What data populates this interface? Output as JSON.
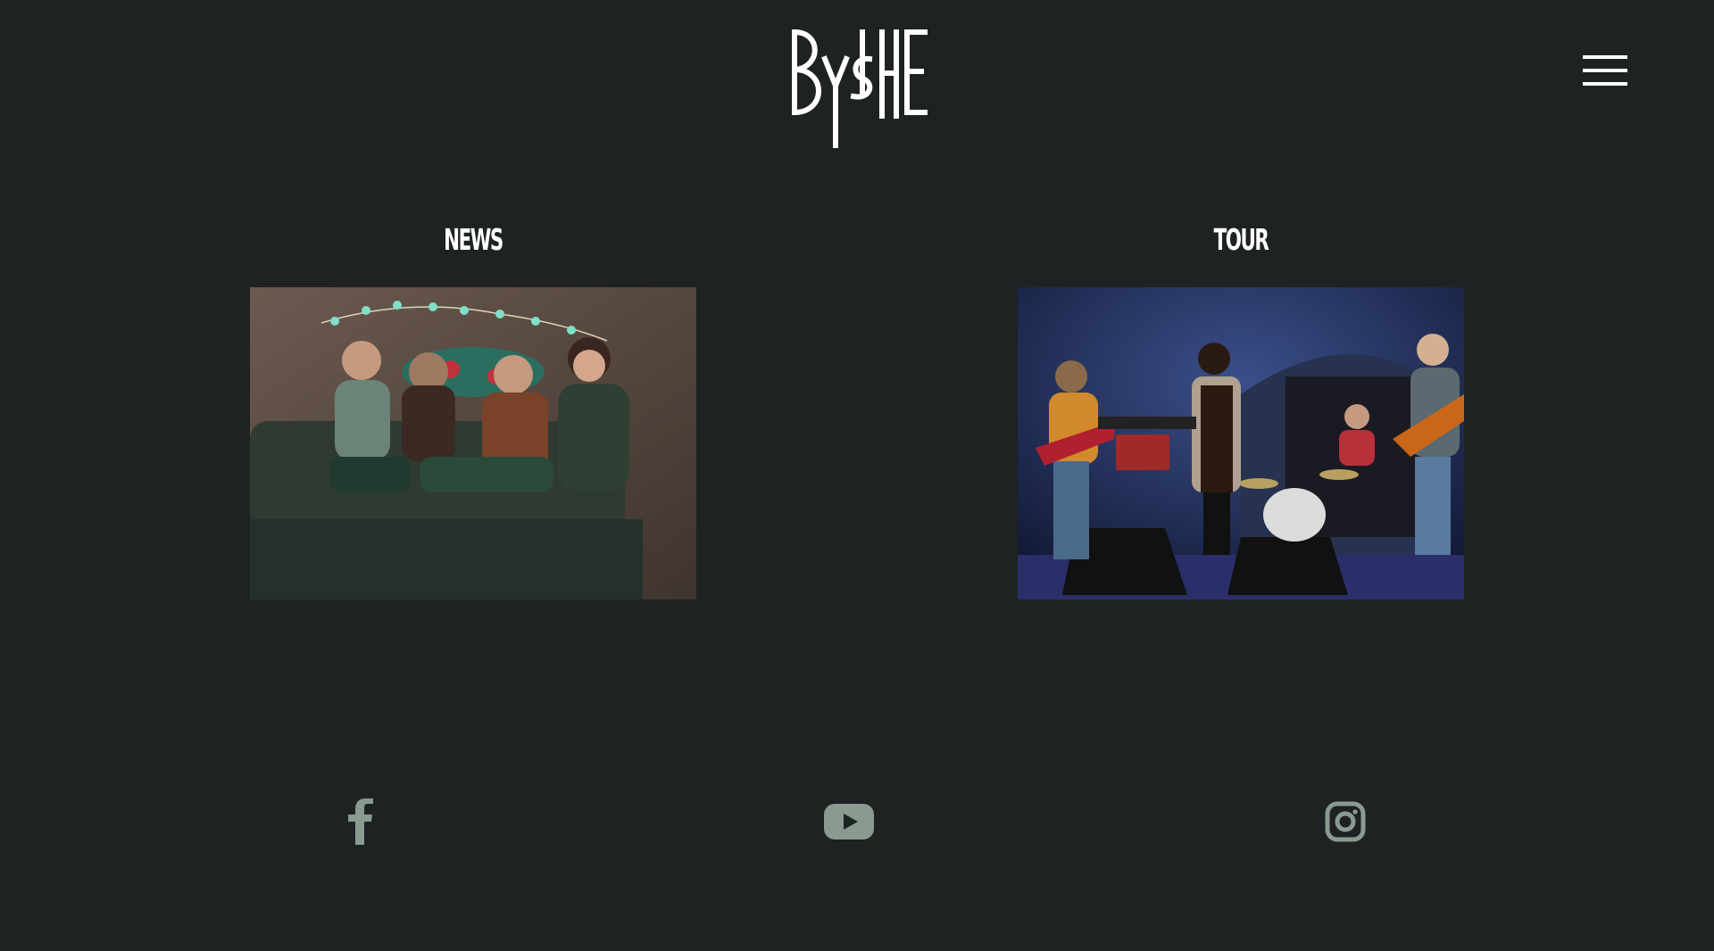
{
  "header": {
    "logo_text": "ByShe",
    "logo_icon": "byshe-monogram-logo",
    "menu_icon": "hamburger-menu-icon"
  },
  "sections": [
    {
      "title": "NEWS",
      "photo_subject": "band-seated-on-sofa-photo"
    },
    {
      "title": "TOUR",
      "photo_subject": "band-live-on-stage-photo"
    }
  ],
  "social": [
    {
      "icon": "facebook-icon"
    },
    {
      "icon": "youtube-icon"
    },
    {
      "icon": "instagram-icon"
    }
  ],
  "colors": {
    "background": "#1e2223",
    "text": "#ffffff",
    "social_icon": "#8a9a90"
  }
}
